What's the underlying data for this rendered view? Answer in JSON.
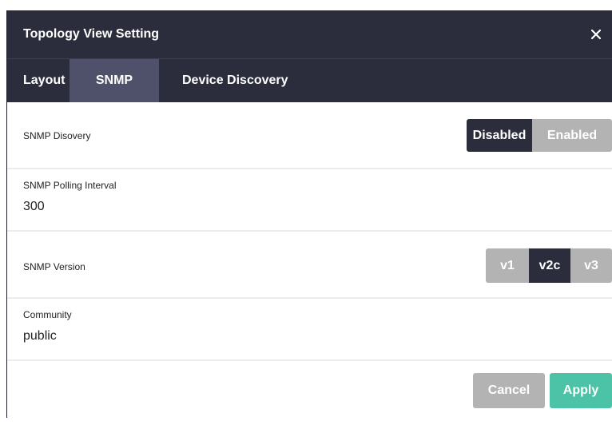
{
  "dialog": {
    "title": "Topology View Setting",
    "close_icon": "close-icon"
  },
  "tabs": [
    {
      "label": "Layout",
      "active": false
    },
    {
      "label": "SNMP",
      "active": true
    },
    {
      "label": "Device Discovery",
      "active": false
    }
  ],
  "snmp_discovery": {
    "label": "SNMP Disovery",
    "options": [
      "Disabled",
      "Enabled"
    ],
    "selected": "Disabled"
  },
  "snmp_polling": {
    "label": "SNMP Polling Interval",
    "value": "300"
  },
  "snmp_version": {
    "label": "SNMP Version",
    "options": [
      "v1",
      "v2c",
      "v3"
    ],
    "selected": "v2c"
  },
  "community": {
    "label": "Community",
    "value": "public"
  },
  "footer": {
    "cancel_label": "Cancel",
    "apply_label": "Apply"
  },
  "colors": {
    "header_bg": "#2b2d3c",
    "active_tab_bg": "#4e5169",
    "inactive_option": "#b3b3b3",
    "apply_button": "#4cc2a6"
  }
}
